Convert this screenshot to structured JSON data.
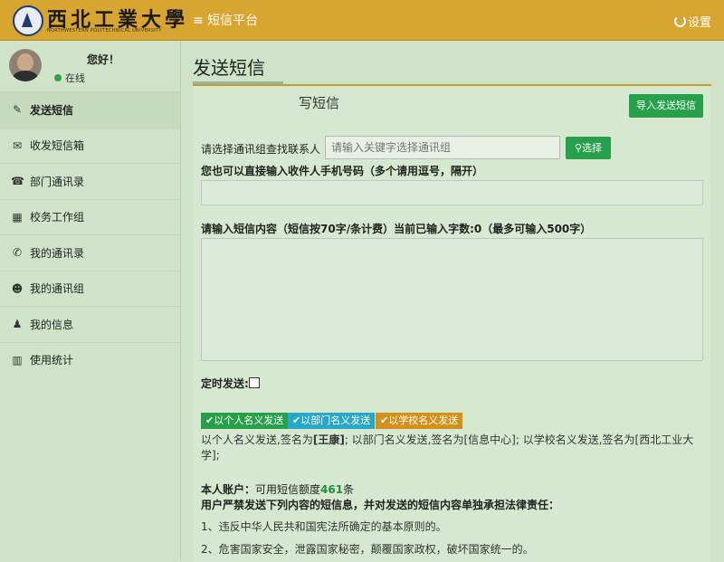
{
  "header": {
    "logo_cn": "西北工業大學",
    "logo_en": "NORTHWESTERN POLYTECHNICAL UNIVERSITY",
    "platform_icon": "menu-icon",
    "platform_title": "短信平台",
    "settings_icon": "refresh-icon",
    "settings_label": "设置"
  },
  "user": {
    "greeting": "您好！",
    "status": "在线"
  },
  "sidebar": {
    "items": [
      {
        "icon": "edit-icon",
        "glyph": "✎",
        "label": "发送短信",
        "active": true
      },
      {
        "icon": "envelope-icon",
        "glyph": "✉",
        "label": "收发短信箱"
      },
      {
        "icon": "address-book-icon",
        "glyph": "☎",
        "label": "部门通讯录"
      },
      {
        "icon": "building-icon",
        "glyph": "▦",
        "label": "校务工作组"
      },
      {
        "icon": "phone-icon",
        "glyph": "✆",
        "label": "我的通讯录"
      },
      {
        "icon": "group-icon",
        "glyph": "☻",
        "label": "我的通讯组"
      },
      {
        "icon": "user-icon",
        "glyph": "♟",
        "label": "我的信息"
      },
      {
        "icon": "bar-chart-icon",
        "glyph": "▥",
        "label": "使用统计"
      }
    ]
  },
  "main": {
    "page_title": "发送短信",
    "panel_heading": "写短信",
    "import_button": "导入发送短信",
    "group_search_label": "请选择通讯组查找联系人",
    "group_search_placeholder": "请输入关键字选择通讯组",
    "select_button": "选择",
    "phone_label": "您也可以直接输入收件人手机号码（多个请用逗号，隔开）",
    "content_label": "请输入短信内容（短信按70字/条计费）当前已输入字数:0（最多可输入500字）",
    "schedule_label": "定时发送:",
    "send_personal": "以个人名义发送",
    "send_department": "以部门名义发送",
    "send_school": "以学校名义发送",
    "signature_note_a": "以个人名义发送,签名为",
    "signature_note_personal": "[王康]",
    "signature_note_b": "; 以部门名义发送,签名为[信息中心]; 以学校名义发送,签名为[西北工业大学];",
    "quota_label": "本人账户：",
    "quota_text_a": "可用短信额度",
    "quota_value": "461",
    "quota_text_b": "条",
    "warning": "用户严禁发送下列内容的短信息，并对发送的短信内容单独承担法律责任：",
    "rule1": "1、违反中华人民共和国宪法所确定的基本原则的。",
    "rule2": "2、危害国家安全，泄露国家秘密，颠覆国家政权，破坏国家统一的。"
  },
  "colors": {
    "header": "#d9a531",
    "primary_button": "#27a04b",
    "info_button": "#27a8c7",
    "warning_button": "#d49119",
    "background": "#cfe3c8"
  }
}
